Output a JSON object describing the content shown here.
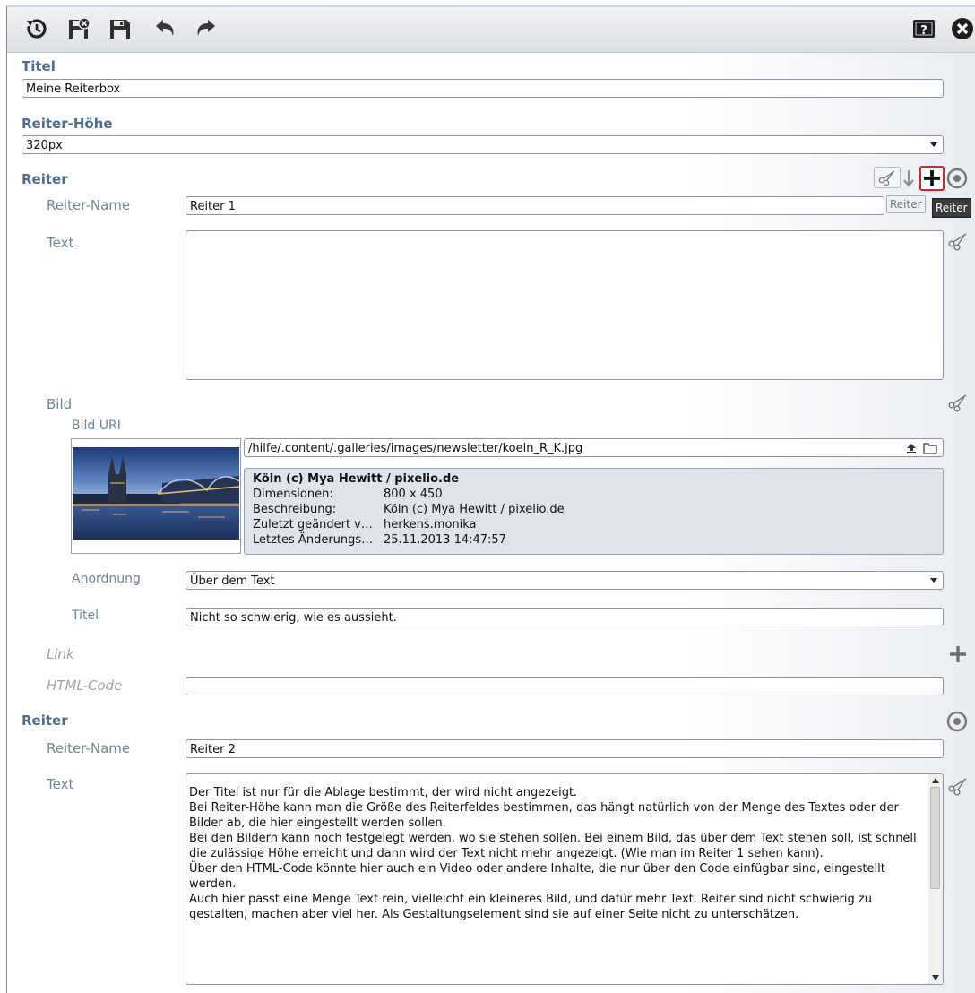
{
  "toolbar": {
    "icons": [
      "history-icon",
      "discard-save-icon",
      "save-icon",
      "undo-icon",
      "redo-icon",
      "help-icon",
      "close-icon"
    ]
  },
  "form": {
    "titel_label": "Titel",
    "titel_value": "Meine Reiterbox",
    "height_label": "Reiter-Höhe",
    "height_value": "320px"
  },
  "reiter1": {
    "section_label": "Reiter",
    "name_label": "Reiter-Name",
    "name_value": "Reiter 1",
    "text_label": "Text",
    "bild_label": "Bild",
    "bild_uri_label": "Bild URI",
    "bild_uri_value": "/hilfe/.content/.galleries/images/newsletter/koeln_R_K.jpg",
    "image_info": {
      "title": "Köln (c) Mya Hewitt / pixelio.de",
      "rows": [
        {
          "k": "Dimensionen:",
          "v": "800 x 450"
        },
        {
          "k": "Beschreibung:",
          "v": "Köln (c) Mya Hewitt / pixelio.de"
        },
        {
          "k": "Zuletzt geändert v…",
          "v": "herkens.monika"
        },
        {
          "k": "Letztes Änderungs…",
          "v": "25.11.2013 14:47:57"
        }
      ]
    },
    "anordnung_label": "Anordnung",
    "anordnung_value": "Über dem Text",
    "bild_titel_label": "Titel",
    "bild_titel_value": "Nicht so schwierig, wie es aussieht.",
    "link_label": "Link",
    "html_label": "HTML-Code",
    "html_value": "",
    "tooltip_light": "Reiter",
    "tooltip_dark": "Reiter"
  },
  "reiter2": {
    "section_label": "Reiter",
    "name_label": "Reiter-Name",
    "name_value": "Reiter 2",
    "text_label": "Text",
    "paragraphs": [
      "Der Titel ist nur für die Ablage bestimmt, der wird nicht angezeigt.",
      "Bei Reiter-Höhe kann man die Größe des Reiterfeldes bestimmen, das hängt natürlich von der Menge des Textes oder der Bilder ab, die hier eingestellt werden sollen.",
      "Bei den Bildern kann noch festgelegt werden, wo sie stehen sollen. Bei einem Bild, das über dem Text stehen soll, ist schnell die zulässige Höhe erreicht und dann wird der Text nicht mehr angezeigt. (Wie man im Reiter 1 sehen kann).",
      "Über den HTML-Code könnte hier auch ein Video oder andere Inhalte, die nur über den Code einfügbar sind, eingestellt werden.",
      "Auch hier passt eine Menge Text rein, vielleicht ein kleineres Bild, und dafür mehr Text. Reiter sind nicht schwierig zu gestalten, machen aber viel her. Als Gestaltungselement sind sie auf einer Seite nicht zu unterschätzen."
    ]
  },
  "colors": {
    "section_label": "#4f6e8f",
    "field_label": "#6f86a0",
    "highlight": "#e02020"
  }
}
